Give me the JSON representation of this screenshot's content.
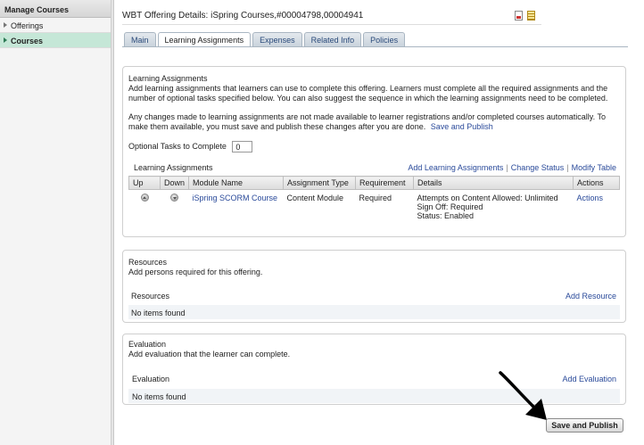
{
  "sidebar": {
    "header": "Manage Courses",
    "items": [
      {
        "label": "Offerings"
      },
      {
        "label": "Courses"
      }
    ]
  },
  "page": {
    "title": "WBT Offering Details: iSpring Courses,#00004798,00004941"
  },
  "tabs": [
    "Main",
    "Learning Assignments",
    "Expenses",
    "Related Info",
    "Policies"
  ],
  "learning": {
    "title": "Learning Assignments",
    "desc": "Add learning assignments that learners can use to complete this offering. Learners must complete all the required assignments and the number of optional tasks specified below. You can also suggest the sequence in which the learning assignments need to be completed.",
    "notice": "Any changes made to learning assignments are not made available to learner registrations and/or completed courses automatically. To make them available, you must save and publish these changes after you are done.",
    "notice_link": "Save and Publish",
    "optional_label": "Optional Tasks to Complete",
    "optional_value": "0",
    "sub_title": "Learning Assignments",
    "links": [
      "Add Learning Assignments",
      "Change Status",
      "Modify Table"
    ],
    "columns": [
      "Up",
      "Down",
      "Module Name",
      "Assignment Type",
      "Requirement",
      "Details",
      "Actions"
    ],
    "rows": [
      {
        "module": "iSpring SCORM Course",
        "type": "Content Module",
        "requirement": "Required",
        "details": [
          "Attempts on Content Allowed: Unlimited",
          "Sign Off: Required",
          "Status: Enabled"
        ],
        "action": "Actions"
      }
    ]
  },
  "resources": {
    "title": "Resources",
    "desc": "Add persons required for this offering.",
    "sub_title": "Resources",
    "add_link": "Add Resource",
    "empty": "No items found"
  },
  "evaluation": {
    "title": "Evaluation",
    "desc": "Add evaluation that the learner can complete.",
    "sub_title": "Evaluation",
    "add_link": "Add Evaluation",
    "empty": "No items found"
  },
  "footer": {
    "save_label": "Save and Publish"
  }
}
